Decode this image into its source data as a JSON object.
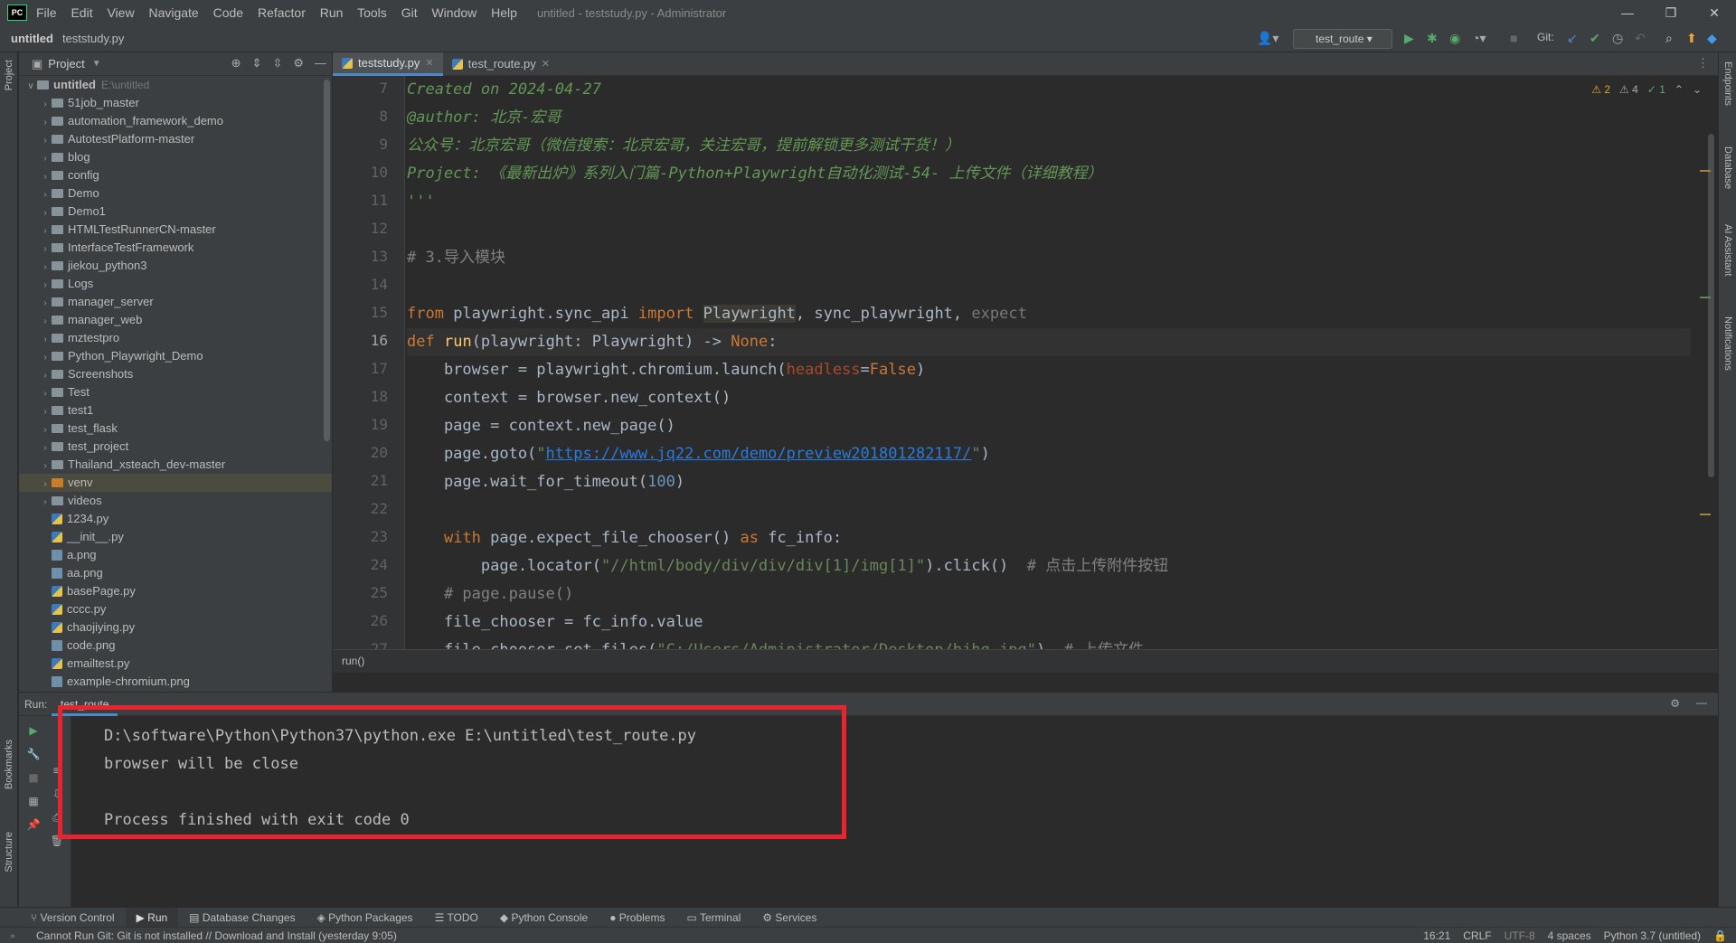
{
  "titlebar": {
    "logo": "PC",
    "menu": [
      "File",
      "Edit",
      "View",
      "Navigate",
      "Code",
      "Refactor",
      "Run",
      "Tools",
      "Git",
      "Window",
      "Help"
    ],
    "title": "untitled - teststudy.py - Administrator",
    "controls": [
      "—",
      "❐",
      "✕"
    ]
  },
  "navbar": {
    "project": "untitled",
    "file": "teststudy.py",
    "run_config": "test_route",
    "git_label": "Git:"
  },
  "project_panel": {
    "title": "Project",
    "root": "untitled",
    "root_path": "E:\\untitled",
    "folders": [
      "51job_master",
      "automation_framework_demo",
      "AutotestPlatform-master",
      "blog",
      "config",
      "Demo",
      "Demo1",
      "HTMLTestRunnerCN-master",
      "InterfaceTestFramework",
      "jiekou_python3",
      "Logs",
      "manager_server",
      "manager_web",
      "mztestpro",
      "Python_Playwright_Demo",
      "Screenshots",
      "Test",
      "test1",
      "test_flask",
      "test_project",
      "Thailand_xsteach_dev-master",
      "venv",
      "videos"
    ],
    "files": [
      "1234.py",
      "__init__.py",
      "a.png",
      "aa.png",
      "basePage.py",
      "cccc.py",
      "chaojiying.py",
      "code.png",
      "emailtest.py",
      "example-chromium.png"
    ]
  },
  "editor": {
    "tabs": [
      {
        "label": "teststudy.py",
        "active": true
      },
      {
        "label": "test_route.py",
        "active": false
      }
    ],
    "line_numbers": [
      "7",
      "8",
      "9",
      "10",
      "11",
      "12",
      "13",
      "14",
      "15",
      "16",
      "17",
      "18",
      "19",
      "20",
      "21",
      "22",
      "23",
      "24",
      "25",
      "26",
      "27"
    ],
    "current_line": "16",
    "inspections": {
      "warnings": "2",
      "weak": "4",
      "ok": "1"
    },
    "breadcrumb": "run()"
  },
  "run_panel": {
    "label": "Run:",
    "tab": "test_route",
    "output": [
      "D:\\software\\Python\\Python37\\python.exe E:\\untitled\\test_route.py",
      "browser will be close",
      "",
      "Process finished with exit code 0"
    ]
  },
  "bottom_tabs": [
    "Version Control",
    "Run",
    "Database Changes",
    "Python Packages",
    "TODO",
    "Python Console",
    "Problems",
    "Terminal",
    "Services"
  ],
  "statusbar": {
    "message": "Cannot Run Git: Git is not installed // Download and Install (yesterday 9:05)",
    "position": "16:21",
    "line_sep": "CRLF",
    "encoding": "UTF-8",
    "indent": "4 spaces",
    "interpreter": "Python 3.7 (untitled)"
  },
  "side_labels": {
    "left": [
      "Project",
      "Bookmarks",
      "Structure"
    ],
    "right": [
      "Endpoints",
      "Database",
      "AI Assistant",
      "Notifications"
    ]
  },
  "colors": {
    "highlight_box": "#e8252f",
    "accent": "#4a88c7"
  }
}
